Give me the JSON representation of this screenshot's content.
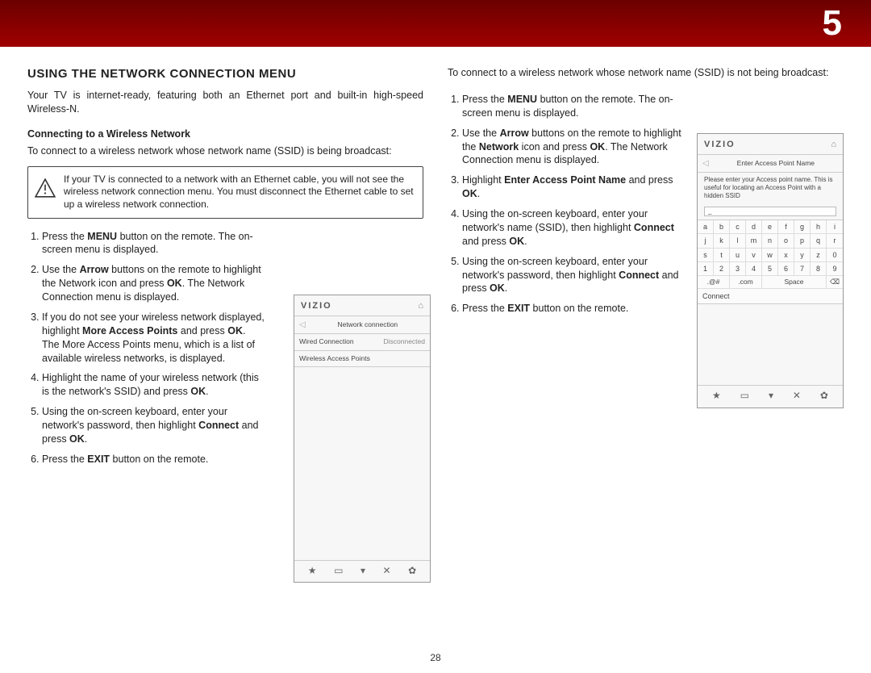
{
  "chapter_number": "5",
  "page_number": "28",
  "section_title": "USING THE NETWORK CONNECTION MENU",
  "intro": "Your TV is internet-ready, featuring both an Ethernet port and built-in high-speed Wireless-N.",
  "subhead1": "Connecting to a Wireless Network",
  "subhead1_intro": "To connect to a wireless network whose network name (SSID) is being broadcast:",
  "warning_text": "If your TV is connected to a network with an Ethernet cable, you will not see the wireless network connection menu. You must disconnect the Ethernet cable to set up a wireless network connection.",
  "steps_a": [
    {
      "pre": "Press the ",
      "b": "MENU",
      "post": " button on the remote. The on-screen menu is displayed."
    },
    {
      "pre": "Use the ",
      "b": "Arrow",
      "post": " buttons on the remote to highlight the Network icon and press ",
      "b2": "OK",
      "post2": ". The Network Connection menu is displayed."
    },
    {
      "pre": "If you do not see your wireless network displayed, highlight ",
      "b": "More Access Points",
      "post": " and press ",
      "b2": "OK",
      "post2": ". The More Access Points menu, which is a list of available wireless networks, is displayed."
    },
    {
      "pre": "Highlight the name of your wireless network (this is the network's SSID) and press ",
      "b": "OK",
      "post": "."
    },
    {
      "pre": "Using the on-screen keyboard, enter your network's password, then highlight ",
      "b": "Connect",
      "post": " and press ",
      "b2": "OK",
      "post2": "."
    },
    {
      "pre": "Press the ",
      "b": "EXIT",
      "post": " button on the remote."
    }
  ],
  "right_intro": "To connect to a wireless network whose network name (SSID) is not being broadcast:",
  "steps_b": [
    {
      "pre": "Press the ",
      "b": "MENU",
      "post": " button on the remote. The on-screen menu is displayed."
    },
    {
      "pre": "Use the ",
      "b": "Arrow",
      "post": " buttons on the remote to highlight the ",
      "b2": "Network",
      "post2": " icon and press ",
      "b3": "OK",
      "post3": ". The Network Connection menu is displayed."
    },
    {
      "pre": "Highlight ",
      "b": "Enter Access Point Name",
      "post": " and press ",
      "b2": "OK",
      "post2": "."
    },
    {
      "pre": "Using the on-screen keyboard, enter your network's name (SSID), then highlight ",
      "b": "Connect",
      "post": " and press ",
      "b2": "OK",
      "post2": "."
    },
    {
      "pre": "Using the on-screen keyboard, enter your network's password, then highlight ",
      "b": "Connect",
      "post": " and press ",
      "b2": "OK",
      "post2": "."
    },
    {
      "pre": "Press the ",
      "b": "EXIT",
      "post": " button on the remote."
    }
  ],
  "tv_left": {
    "brand": "VIZIO",
    "title": "Network connection",
    "row1_label": "Wired Connection",
    "row1_value": "Disconnected",
    "row2_label": "Wireless Access Points",
    "icons": [
      "★",
      "▭",
      "▾",
      "✕",
      "✿"
    ]
  },
  "tv_right": {
    "brand": "VIZIO",
    "title": "Enter Access Point Name",
    "desc": "Please enter your Access point name. This is useful for locating an Access Point with a hidden SSID",
    "input_value": "_",
    "keys_row1": [
      "a",
      "b",
      "c",
      "d",
      "e",
      "f",
      "g",
      "h",
      "i"
    ],
    "keys_row2": [
      "j",
      "k",
      "l",
      "m",
      "n",
      "o",
      "p",
      "q",
      "r"
    ],
    "keys_row3": [
      "s",
      "t",
      "u",
      "v",
      "w",
      "x",
      "y",
      "z",
      "0"
    ],
    "keys_row4": [
      "1",
      "2",
      "3",
      "4",
      "5",
      "6",
      "7",
      "8",
      "9"
    ],
    "keys_bottom": [
      ".@#",
      ".com",
      "Space",
      "⌫"
    ],
    "connect_label": "Connect",
    "icons": [
      "★",
      "▭",
      "▾",
      "✕",
      "✿"
    ]
  }
}
